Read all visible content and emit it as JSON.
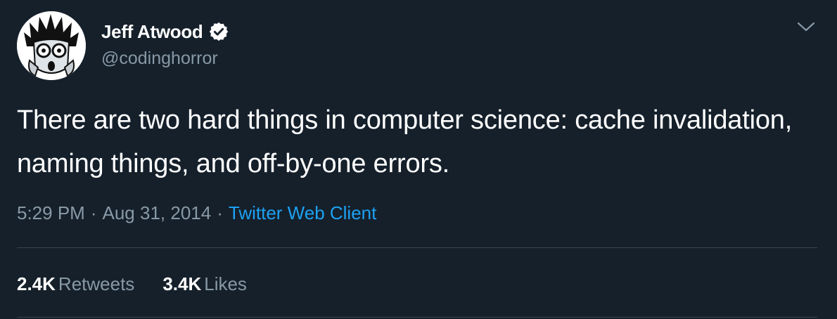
{
  "author": {
    "display_name": "Jeff Atwood",
    "handle": "@codinghorror",
    "verified_icon": "verified-badge-icon",
    "avatar": "coding-horror-logo"
  },
  "tweet": {
    "text": "There are two hard things in computer science: cache invalidation, naming things, and off-by-one errors.",
    "time": "5:29 PM",
    "separator": "·",
    "date": "Aug 31, 2014",
    "client": "Twitter Web Client"
  },
  "stats": {
    "retweets_count": "2.4K",
    "retweets_label": "Retweets",
    "likes_count": "3.4K",
    "likes_label": "Likes"
  },
  "menu_icon": "chevron-down-icon",
  "colors": {
    "background": "#15202b",
    "primary_text": "#ffffff",
    "secondary_text": "#8899a6",
    "link": "#1da1f2",
    "divider": "#38444d"
  }
}
